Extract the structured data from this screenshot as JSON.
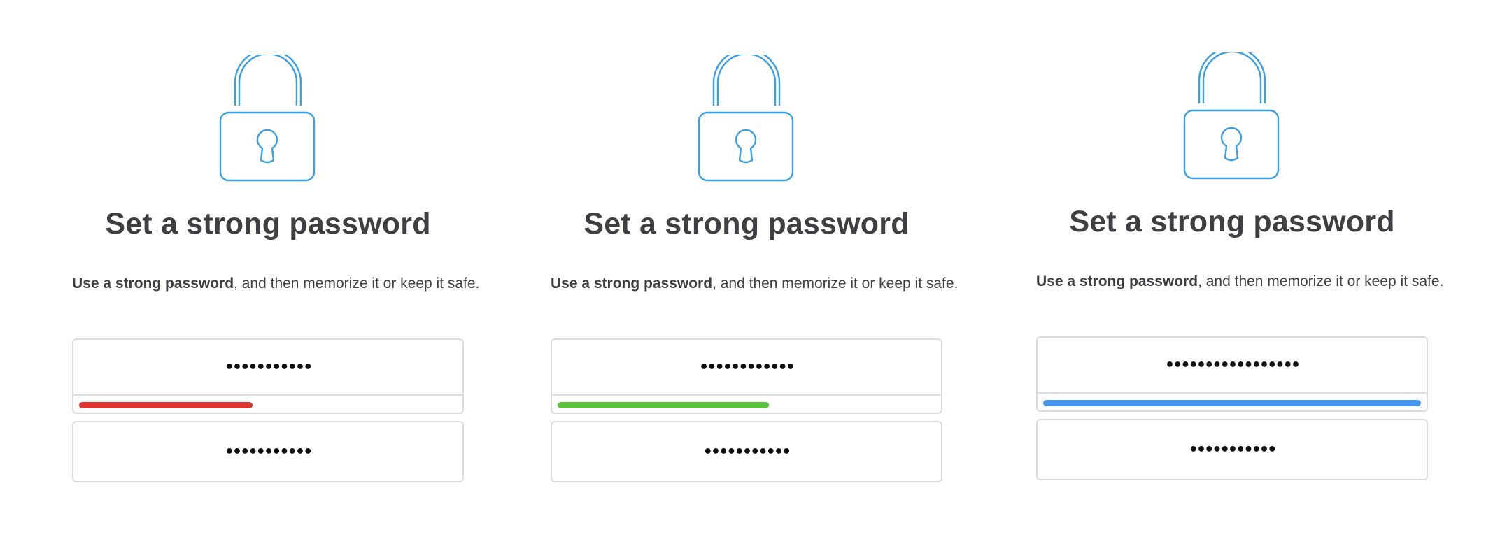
{
  "accent_color": "#3aa0e6",
  "panels": [
    {
      "lock_icon": "padlock-icon",
      "title": "Set a strong password",
      "desc_bold": "Use a strong password",
      "desc_rest": ", and then memorize it or keep it safe.",
      "password_masked": "•••••••••••",
      "strength_fraction": 0.46,
      "strength_color": "#e0342f",
      "confirm_masked": "•••••••••••"
    },
    {
      "lock_icon": "padlock-icon",
      "title": "Set a strong password",
      "desc_bold": "Use a strong password",
      "desc_rest": ", and then memorize it or keep it safe.",
      "password_masked": "••••••••••••",
      "strength_fraction": 0.56,
      "strength_color": "#5bc23c",
      "confirm_masked": "•••••••••••"
    },
    {
      "lock_icon": "padlock-icon",
      "title": "Set a strong password",
      "desc_bold": "Use a strong password",
      "desc_rest": ", and then memorize it or keep it safe.",
      "password_masked": "•••••••••••••••••",
      "strength_fraction": 1.0,
      "strength_color": "#4596ea",
      "confirm_masked": "•••••••••••"
    }
  ]
}
